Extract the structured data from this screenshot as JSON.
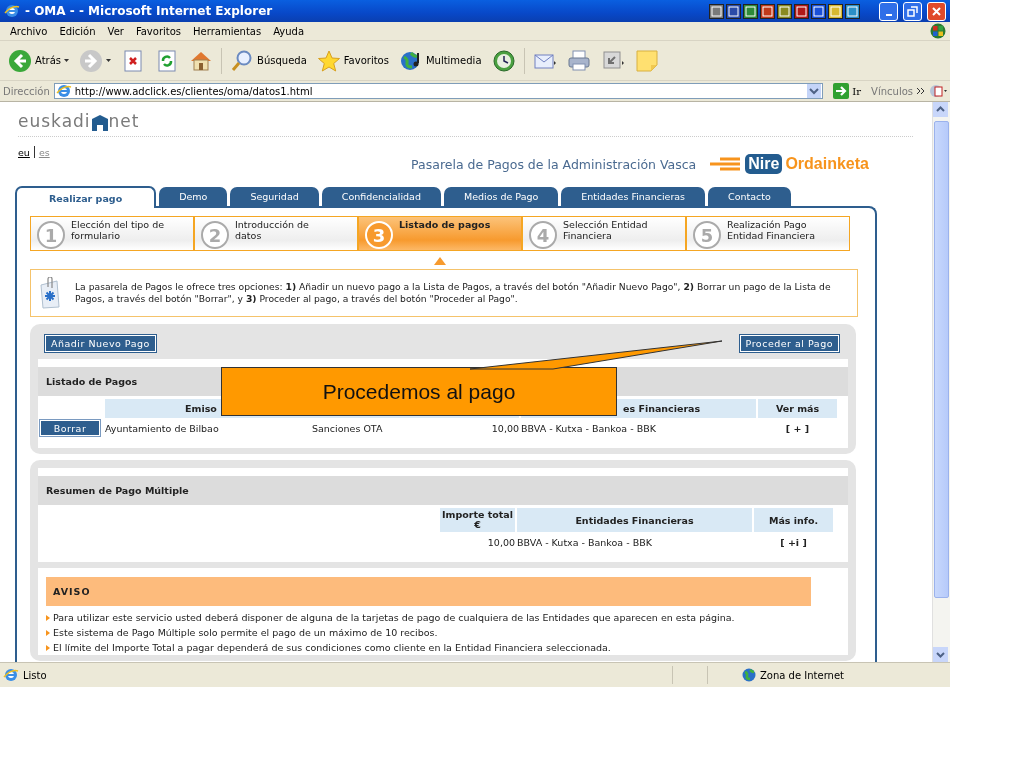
{
  "window": {
    "title": "- OMA - - Microsoft Internet Explorer"
  },
  "menu": [
    "Archivo",
    "Edición",
    "Ver",
    "Favoritos",
    "Herramientas",
    "Ayuda"
  ],
  "toolbar": [
    {
      "kind": "back",
      "label": "Atrás"
    },
    {
      "kind": "forward"
    },
    {
      "kind": "stop"
    },
    {
      "kind": "refresh"
    },
    {
      "kind": "home"
    },
    {
      "kind": "search",
      "label": "Búsqueda"
    },
    {
      "kind": "favorites",
      "label": "Favoritos"
    },
    {
      "kind": "media",
      "label": "Multimedia"
    },
    {
      "kind": "history"
    },
    {
      "kind": "mail"
    },
    {
      "kind": "print"
    },
    {
      "kind": "edit"
    },
    {
      "kind": "note"
    }
  ],
  "address_bar": {
    "label": "Dirección",
    "value": "http://www.adclick.es/clientes/oma/datos1.html",
    "go": "Ir",
    "links": "Vínculos"
  },
  "page": {
    "site_logo": [
      "euskadi",
      "net"
    ],
    "languages": [
      {
        "label": "eu",
        "selected": true
      },
      {
        "label": "es",
        "selected": false
      }
    ],
    "tagline": "Pasarela de Pagos de la Administración Vasca",
    "brand": [
      "Nire",
      "Ordainketa"
    ],
    "tabs": [
      {
        "label": "Realizar pago",
        "selected": true
      },
      {
        "label": "Demo",
        "selected": false
      },
      {
        "label": "Seguridad",
        "selected": false
      },
      {
        "label": "Confidencialidad",
        "selected": false
      },
      {
        "label": "Medios de Pago",
        "selected": false
      },
      {
        "label": "Entidades Financieras",
        "selected": false
      },
      {
        "label": "Contacto",
        "selected": false
      }
    ],
    "steps": [
      {
        "number": "1",
        "label": "Elección del tipo de formulario",
        "selected": false
      },
      {
        "number": "2",
        "label": "Introducción de datos",
        "selected": false
      },
      {
        "number": "3",
        "label": "Listado de pagos",
        "selected": true
      },
      {
        "number": "4",
        "label": "Selección Entidad Financiera",
        "selected": false
      },
      {
        "number": "5",
        "label": "Realización Pago Entidad Financiera",
        "selected": false
      }
    ],
    "info": "La pasarela de Pagos le ofrece tres opciones: **1)** Añadir un nuevo pago a la Lista de Pagos, a través del botón \"Añadir Nuevo Pago\", **2)** Borrar un pago de la Lista de Pagos, a través del botón \"Borrar\", y **3)** Proceder al pago, a través del botón \"Proceder al Pago\".",
    "add_button": "Añadir Nuevo Pago",
    "proceed_button": "Proceder al Pago",
    "payments": {
      "title": "Listado de Pagos",
      "columns": [
        "Emiso",
        "es Financieras",
        "Ver más"
      ],
      "rows": [
        {
          "action": "Borrar",
          "issuer": "Ayuntamiento de Bilbao",
          "concept": "Sanciones OTA",
          "amount": "10,00",
          "entities": "BBVA - Kutxa - Bankoa - BBK",
          "more": "[ + ]"
        }
      ]
    },
    "summary": {
      "title": "Resumen de Pago Múltiple",
      "columns": [
        "Importe total €",
        "Entidades Financieras",
        "Más info."
      ],
      "rows": [
        {
          "amount": "10,00",
          "entities": "BBVA - Kutxa - Bankoa - BBK",
          "more": "[ +i ]"
        }
      ]
    },
    "notice": {
      "title": "AVISO",
      "items": [
        "Para utilizar este servicio usted deberá disponer de alguna de la tarjetas de pago de cualquiera de las Entidades que aparecen en esta página.",
        "Este sistema de Pago Múltiple solo permite el pago de un máximo de 10 recibos.",
        "El límite del Importe Total a pagar dependerá de sus condiciones como cliente en la Entidad Financiera seleccionada."
      ]
    }
  },
  "callout": {
    "text": "Procedemos al pago"
  },
  "status_bar": {
    "text": "Listo",
    "zone": "Zona de Internet"
  }
}
